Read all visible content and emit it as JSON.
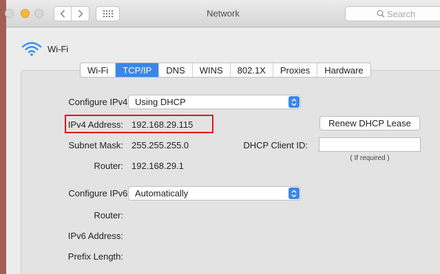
{
  "window": {
    "title": "Network",
    "search_placeholder": "Search"
  },
  "interface": {
    "name": "Wi-Fi",
    "icon": "wifi-icon"
  },
  "tabs": [
    {
      "label": "Wi-Fi",
      "active": false
    },
    {
      "label": "TCP/IP",
      "active": true
    },
    {
      "label": "DNS",
      "active": false
    },
    {
      "label": "WINS",
      "active": false
    },
    {
      "label": "802.1X",
      "active": false
    },
    {
      "label": "Proxies",
      "active": false
    },
    {
      "label": "Hardware",
      "active": false
    }
  ],
  "ipv4": {
    "configure_label": "Configure IPv4:",
    "configure_value": "Using DHCP",
    "address_label": "IPv4 Address:",
    "address_value": "192.168.29.115",
    "subnet_label": "Subnet Mask:",
    "subnet_value": "255.255.255.0",
    "router_label": "Router:",
    "router_value": "192.168.29.1",
    "renew_button": "Renew DHCP Lease",
    "client_id_label": "DHCP Client ID:",
    "client_id_value": "",
    "client_id_hint": "( If required )"
  },
  "ipv6": {
    "configure_label": "Configure IPv6:",
    "configure_value": "Automatically",
    "router_label": "Router:",
    "address_label": "IPv6 Address:",
    "prefix_label": "Prefix Length:"
  },
  "colors": {
    "accent": "#3b87e6",
    "highlight_box": "#e0141a"
  }
}
